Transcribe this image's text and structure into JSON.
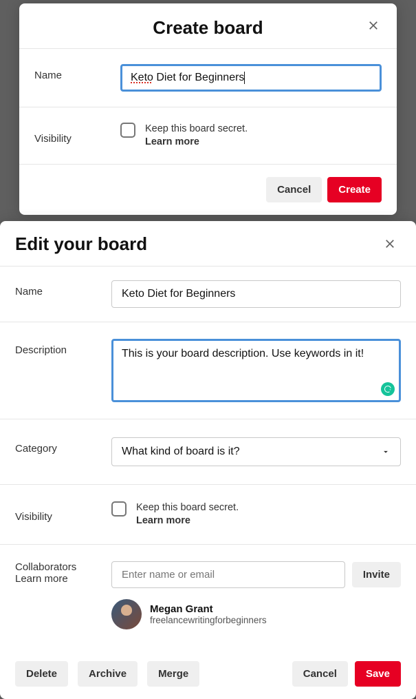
{
  "modal1": {
    "title": "Create board",
    "name_label": "Name",
    "name_value_first": "Keto",
    "name_value_rest": " Diet for Beginners",
    "visibility_label": "Visibility",
    "secret_text": "Keep this board secret.",
    "learn_more": "Learn more",
    "cancel": "Cancel",
    "create": "Create"
  },
  "modal2": {
    "title": "Edit your board",
    "name_label": "Name",
    "name_value": "Keto Diet for Beginners",
    "description_label": "Description",
    "description_value": "This is your board description. Use keywords in it!",
    "category_label": "Category",
    "category_placeholder": "What kind of board is it?",
    "visibility_label": "Visibility",
    "secret_text": "Keep this board secret.",
    "learn_more": "Learn more",
    "collaborators_label": "Collaborators",
    "collaborators_learn_more": "Learn more",
    "collab_placeholder": "Enter name or email",
    "invite": "Invite",
    "collaborator": {
      "name": "Megan Grant",
      "handle": "freelancewritingforbeginners"
    },
    "delete": "Delete",
    "archive": "Archive",
    "merge": "Merge",
    "cancel": "Cancel",
    "save": "Save"
  }
}
